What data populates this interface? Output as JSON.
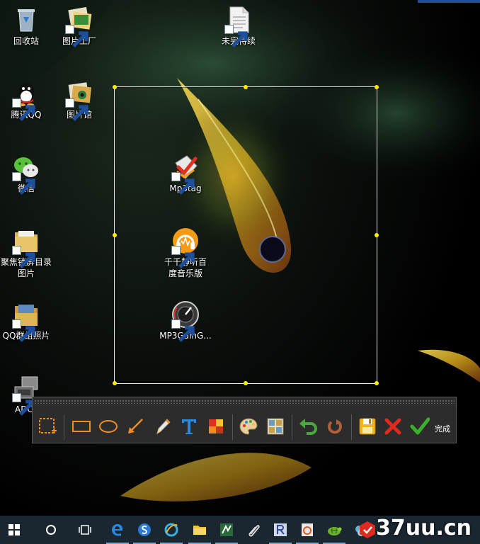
{
  "desktop": {
    "icons": [
      {
        "label": "回收站",
        "icon": "recycle-bin-icon"
      },
      {
        "label": "图片工厂",
        "icon": "photo-factory-icon"
      },
      {
        "label": "未完待续",
        "icon": "document-icon"
      },
      {
        "label": "腾讯QQ",
        "icon": "qq-penguin-icon"
      },
      {
        "label": "图片馆",
        "icon": "photo-gallery-icon"
      },
      {
        "label": "微信",
        "icon": "wechat-icon"
      },
      {
        "label": "聚焦锁屏目录图片",
        "icon": "folder-icon"
      },
      {
        "label": "QQ群组照片",
        "icon": "photo-folder-icon"
      },
      {
        "label": "ADC",
        "icon": "computer-icon"
      },
      {
        "label": "Mp3tag",
        "icon": "mp3tag-icon"
      },
      {
        "label": "千千静听百度音乐版",
        "icon": "headphones-icon"
      },
      {
        "label": "MP3GainG...",
        "icon": "gain-knob-icon"
      }
    ]
  },
  "screenshot_toolbar": {
    "tools": [
      "select-region-icon",
      "rectangle-icon",
      "ellipse-icon",
      "arrow-icon",
      "pencil-icon",
      "text-icon",
      "mosaic-icon",
      "palette-icon",
      "pattern-icon",
      "undo-icon",
      "redo-icon",
      "save-icon",
      "cancel-icon",
      "confirm-icon"
    ],
    "done_label": "完成"
  },
  "taskbar": {
    "buttons": [
      "windows-start-icon",
      "cortana-search-icon",
      "task-view-icon",
      "edge-browser-icon",
      "sogou-icon",
      "ie-browser-icon",
      "file-explorer-icon",
      "app-icon",
      "clip-icon",
      "app-r-icon",
      "music-app-icon",
      "tortoise-icon",
      "app-blue-icon"
    ]
  },
  "watermark": {
    "text": "37uu.cn"
  },
  "colors": {
    "handle": "#ffee00",
    "selection_border": "#e9e9e9",
    "toolbar_bg": "#2c2c2c",
    "taskbar_bg": "#1a2630",
    "accent": "#1e4f9c"
  }
}
